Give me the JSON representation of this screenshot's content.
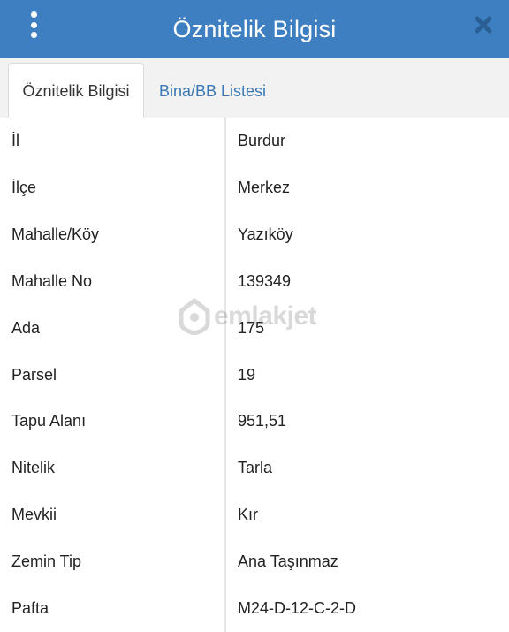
{
  "header": {
    "title": "Öznitelik Bilgisi",
    "background_color": "#3d7fc1",
    "menu_icon": "kebab-menu-icon",
    "close_icon": "close-icon"
  },
  "tabs": [
    {
      "label": "Öznitelik Bilgisi",
      "active": true
    },
    {
      "label": "Bina/BB Listesi",
      "active": false
    }
  ],
  "rows": [
    {
      "label": "İl",
      "value": "Burdur"
    },
    {
      "label": "İlçe",
      "value": "Merkez"
    },
    {
      "label": "Mahalle/Köy",
      "value": "Yazıköy"
    },
    {
      "label": "Mahalle No",
      "value": "139349"
    },
    {
      "label": "Ada",
      "value": "175"
    },
    {
      "label": "Parsel",
      "value": "19"
    },
    {
      "label": "Tapu Alanı",
      "value": "951,51"
    },
    {
      "label": "Nitelik",
      "value": "Tarla"
    },
    {
      "label": "Mevkii",
      "value": "Kır"
    },
    {
      "label": "Zemin Tip",
      "value": "Ana Taşınmaz"
    },
    {
      "label": "Pafta",
      "value": "M24-D-12-C-2-D"
    }
  ],
  "watermark": {
    "text": "emlakjet",
    "icon": "house-pin-icon"
  }
}
